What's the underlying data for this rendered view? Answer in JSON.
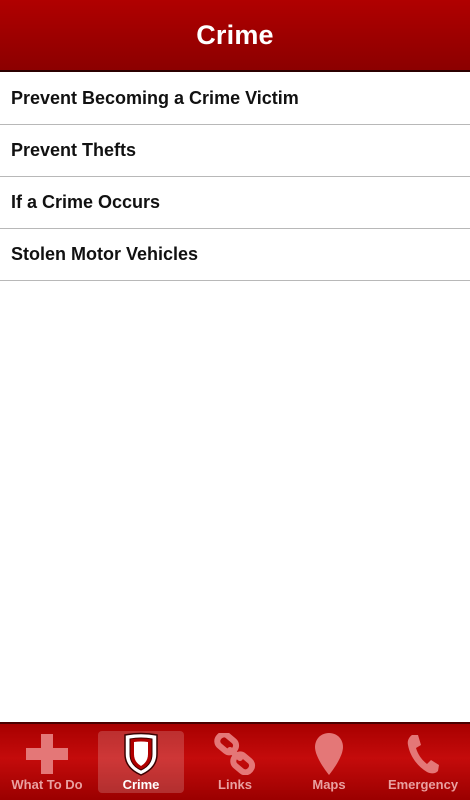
{
  "header": {
    "title": "Crime"
  },
  "list": {
    "items": [
      {
        "label": "Prevent Becoming a Crime Victim"
      },
      {
        "label": "Prevent Thefts"
      },
      {
        "label": "If a Crime Occurs"
      },
      {
        "label": "Stolen Motor Vehicles"
      }
    ]
  },
  "tabbar": {
    "active": "Crime",
    "tabs": [
      {
        "label": "What To Do",
        "icon": "cross-icon"
      },
      {
        "label": "Crime",
        "icon": "shield-icon"
      },
      {
        "label": "Links",
        "icon": "chain-link-icon"
      },
      {
        "label": "Maps",
        "icon": "map-pin-icon"
      },
      {
        "label": "Emergency",
        "icon": "phone-icon"
      }
    ]
  },
  "colors": {
    "brand_red": "#9a0000",
    "inactive_tab_text": "#e9a0a0",
    "active_tab_text": "#ffffff"
  }
}
